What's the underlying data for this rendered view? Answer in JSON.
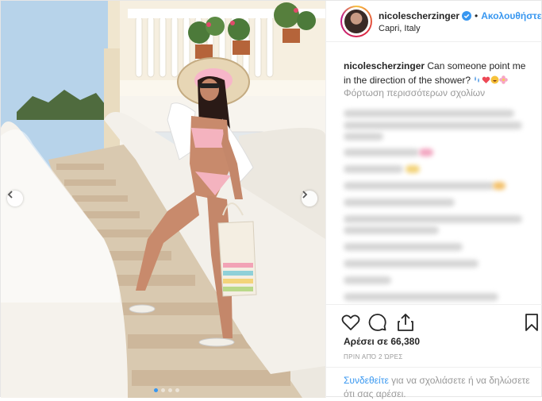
{
  "post": {
    "username": "nicolescherzinger",
    "separator": "•",
    "follow_label": "Ακολουθήστε",
    "location": "Capri, Italy",
    "caption_user": "nicolescherzinger",
    "caption_text": "Can someone point me in the direction of the shower?",
    "caption_emojis": [
      "droplets-emoji",
      "heart-emoji",
      "laughing-emoji",
      "blossom-emoji"
    ],
    "load_more": "Φόρτωση περισσότερων σχολίων",
    "likes": "Αρέσει σε 66,380",
    "time": "ΠΡΙΝ ΑΠΌ 2 ΏΡΕΣ",
    "login_link": "Συνδεθείτε",
    "login_rest": "για να σχολιάσετε ή να δηλώσετε ότι σας αρέσει."
  },
  "icons": {
    "like": "heart-outline-icon",
    "comment": "comment-bubble-icon",
    "share": "share-upload-icon",
    "save": "bookmark-icon",
    "verified": "verified-badge-icon",
    "prev": "chevron-left-icon",
    "next": "chevron-right-icon"
  },
  "carousel": {
    "slides": 4,
    "active": 1
  },
  "colors": {
    "accent": "#3897f0",
    "muted": "#999999",
    "heart": "#ed4956"
  }
}
